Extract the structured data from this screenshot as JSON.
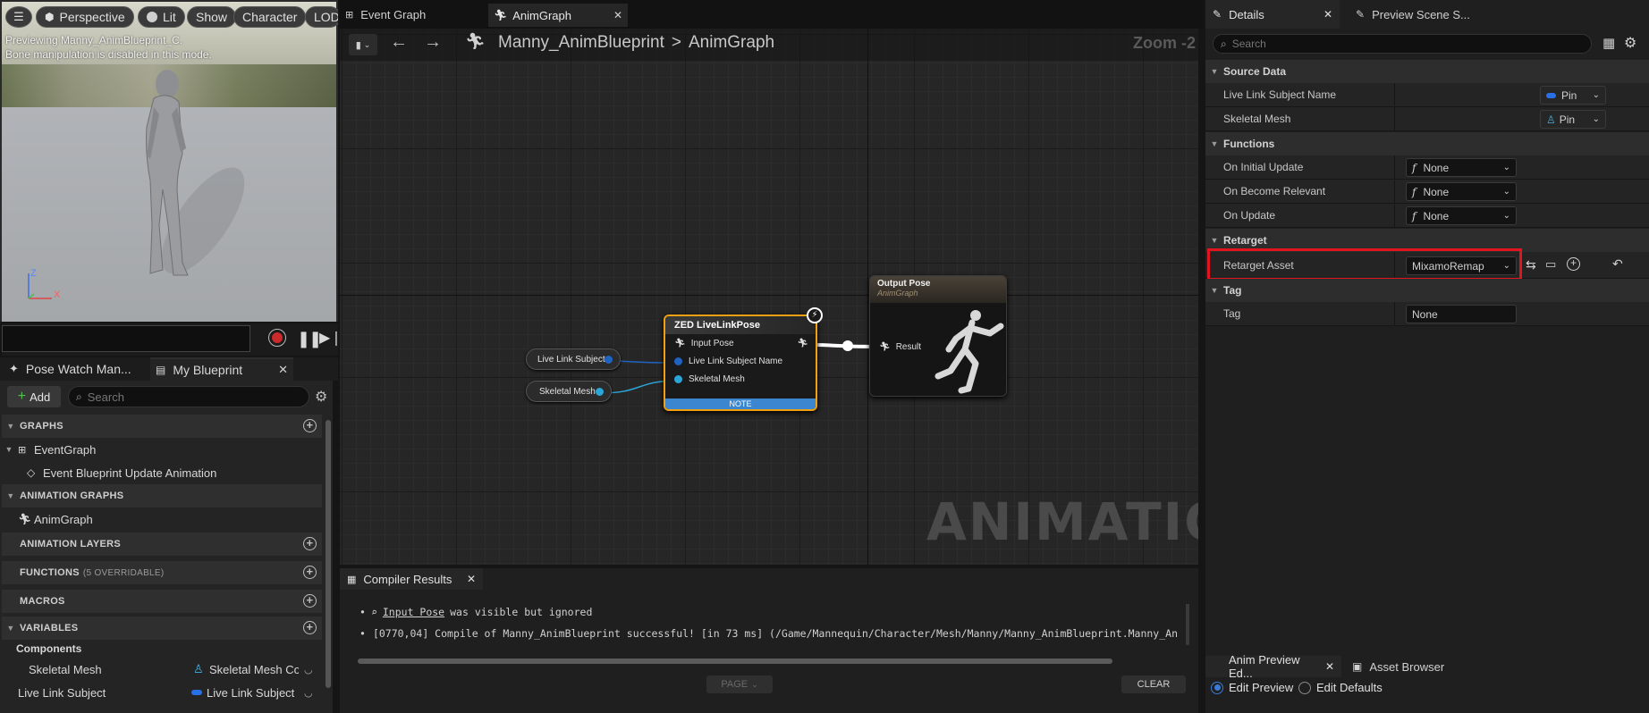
{
  "viewport": {
    "toolbar": {
      "perspective": "Perspective",
      "lit": "Lit",
      "show": "Show",
      "character": "Character",
      "lod": "LOD"
    },
    "info_line1": "Previewing Manny_AnimBlueprint_C.",
    "info_line2": "Bone manipulation is disabled in this mode.",
    "axis_z": "Z",
    "axis_x": "X"
  },
  "left_tabs": {
    "pose_watch": "Pose Watch Man...",
    "my_blueprint": "My Blueprint"
  },
  "my_blueprint": {
    "add_label": "Add",
    "search_placeholder": "Search",
    "sections": {
      "graphs": "GRAPHS",
      "animation_graphs": "ANIMATION GRAPHS",
      "animation_layers": "ANIMATION LAYERS",
      "functions": "FUNCTIONS",
      "functions_sub": "(5 OVERRIDABLE)",
      "macros": "MACROS",
      "variables": "VARIABLES"
    },
    "items": {
      "event_graph": "EventGraph",
      "event_update": "Event Blueprint Update Animation",
      "anim_graph": "AnimGraph",
      "components": "Components",
      "skeletal_mesh": "Skeletal Mesh",
      "skeletal_mesh_type": "Skeletal Mesh Co",
      "live_link_subject": "Live Link Subject",
      "live_link_subject_type": "Live Link Subject I"
    }
  },
  "graph": {
    "tabs": [
      "Event Graph",
      "AnimGraph"
    ],
    "breadcrumb_root": "Manny_AnimBlueprint",
    "breadcrumb_sep": ">",
    "breadcrumb_leaf": "AnimGraph",
    "zoom": "Zoom -2",
    "watermark": "ANIMATION",
    "nodes": {
      "live_link_subject": "Live Link Subject",
      "skeletal_mesh": "Skeletal Mesh",
      "zed_title": "ZED LiveLinkPose",
      "zed_input_pose": "Input Pose",
      "zed_live_link_name": "Live Link Subject Name",
      "zed_skeletal_mesh": "Skeletal Mesh",
      "zed_note": "NOTE",
      "output_title": "Output Pose",
      "output_sub": "AnimGraph",
      "output_result": "Result"
    }
  },
  "compiler": {
    "tab": "Compiler Results",
    "line1_link": "Input Pose",
    "line1_rest": "was visible but ignored",
    "line2": "[0770,04] Compile of Manny_AnimBlueprint successful! [in 73 ms] (/Game/Mannequin/Character/Mesh/Manny/Manny_AnimBlueprint.Manny_An",
    "page": "PAGE",
    "clear": "CLEAR"
  },
  "details": {
    "tabs": {
      "details": "Details",
      "preview_scene": "Preview Scene S..."
    },
    "search_placeholder": "Search",
    "sections": {
      "source_data": "Source Data",
      "functions": "Functions",
      "retarget": "Retarget",
      "tag": "Tag"
    },
    "rows": {
      "live_link_subject_name": "Live Link Subject Name",
      "skeletal_mesh": "Skeletal Mesh",
      "pin": "Pin",
      "on_initial_update": "On Initial Update",
      "on_become_relevant": "On Become Relevant",
      "on_update": "On Update",
      "none": "None",
      "retarget_asset": "Retarget Asset",
      "retarget_value": "MixamoRemap",
      "tag": "Tag",
      "tag_value": "None"
    },
    "highlight_color": "#e0151f"
  },
  "bottom": {
    "anim_preview": "Anim Preview Ed...",
    "asset_browser": "Asset Browser",
    "edit_preview": "Edit Preview",
    "edit_defaults": "Edit Defaults"
  }
}
